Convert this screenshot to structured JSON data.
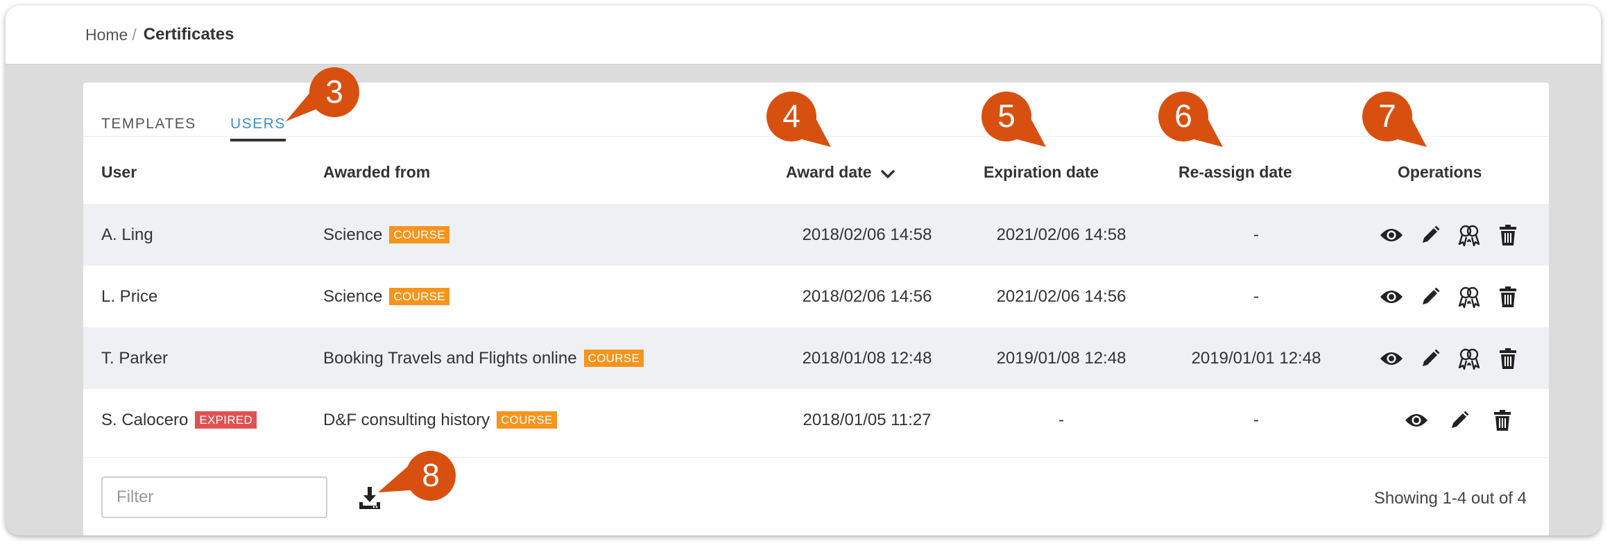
{
  "breadcrumb": {
    "home": "Home",
    "separator": "/",
    "current": "Certificates"
  },
  "tabs": [
    {
      "label": "TEMPLATES",
      "active": false
    },
    {
      "label": "USERS",
      "active": true
    }
  ],
  "table": {
    "headers": {
      "user": "User",
      "awarded_from": "Awarded from",
      "award_date": "Award date",
      "expiration_date": "Expiration date",
      "reassign_date": "Re-assign date",
      "operations": "Operations"
    },
    "rows": [
      {
        "user": "A. Ling",
        "user_badge": "",
        "awarded_from": "Science",
        "type_badge": "COURSE",
        "award_date": "2018/02/06 14:58",
        "expiration_date": "2021/02/06 14:58",
        "reassign_date": "-"
      },
      {
        "user": "L. Price",
        "user_badge": "",
        "awarded_from": "Science",
        "type_badge": "COURSE",
        "award_date": "2018/02/06 14:56",
        "expiration_date": "2021/02/06 14:56",
        "reassign_date": "-"
      },
      {
        "user": "T. Parker",
        "user_badge": "",
        "awarded_from": "Booking Travels and Flights online",
        "type_badge": "COURSE",
        "award_date": "2018/01/08 12:48",
        "expiration_date": "2019/01/08 12:48",
        "reassign_date": "2019/01/01 12:48"
      },
      {
        "user": "S. Calocero",
        "user_badge": "EXPIRED",
        "awarded_from": "D&F consulting history",
        "type_badge": "COURSE",
        "award_date": "2018/01/05 11:27",
        "expiration_date": "-",
        "reassign_date": "-"
      }
    ],
    "row_operations": [
      "eye-icon",
      "pencil-icon",
      "reassign-icon",
      "trash-icon"
    ]
  },
  "footer": {
    "filter_placeholder": "Filter",
    "showing": "Showing 1-4 out of 4"
  },
  "callouts": [
    "3",
    "4",
    "5",
    "6",
    "7",
    "8"
  ],
  "colors": {
    "accent": "#3d8fc8",
    "course_badge": "#f7941d",
    "expired_badge": "#e05151",
    "callout": "#d8500f",
    "row_shade": "#eef0f4"
  }
}
